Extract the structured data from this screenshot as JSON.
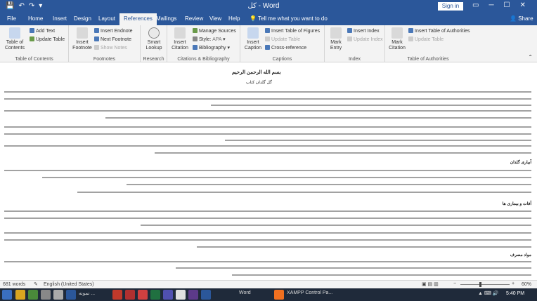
{
  "window": {
    "title": "کل - Word",
    "sign_in": "Sign in",
    "share": "Share",
    "tell_me": "Tell me what you want to do"
  },
  "tabs": [
    "File",
    "Home",
    "Insert",
    "Design",
    "Layout",
    "References",
    "Mailings",
    "Review",
    "View",
    "Help"
  ],
  "active_tab": "References",
  "ribbon": {
    "toc": {
      "table_of_contents": "Table of Contents",
      "add_text": "Add Text",
      "update_table": "Update Table",
      "group": "Table of Contents"
    },
    "footnotes": {
      "insert_footnote": "Insert Footnote",
      "insert_endnote": "Insert Endnote",
      "next_footnote": "Next Footnote",
      "show_notes": "Show Notes",
      "group": "Footnotes"
    },
    "research": {
      "smart_lookup": "Smart Lookup",
      "group": "Research"
    },
    "citations": {
      "insert_citation": "Insert Citation",
      "manage_sources": "Manage Sources",
      "style_label": "Style:",
      "style_value": "APA",
      "bibliography": "Bibliography",
      "group": "Citations & Bibliography"
    },
    "captions": {
      "insert_caption": "Insert Caption",
      "insert_table_of_figures": "Insert Table of Figures",
      "update_table": "Update Table",
      "cross_reference": "Cross-reference",
      "group": "Captions"
    },
    "index": {
      "mark_entry": "Mark Entry",
      "insert_index": "Insert Index",
      "update_index": "Update Index",
      "group": "Index"
    },
    "toa": {
      "mark_citation": "Mark Citation",
      "insert_toa": "Insert Table of Authorities",
      "update_table": "Update Table",
      "group": "Table of Authorities"
    }
  },
  "document": {
    "basmala": "بسم الله الرحمن الرحیم",
    "subtitle": "گل گلدان کتاب",
    "heading1": "آبیاری گلدان",
    "heading2": "آفات و بیماری ها",
    "heading3": "مواد مصرف"
  },
  "status": {
    "words": "681 words",
    "language": "English (United States)",
    "zoom": "60%"
  },
  "taskbar": {
    "item1": "نمونه ...",
    "item2": "Word",
    "item3": "XAMPP Control Pa...",
    "time": "5:40 PM"
  }
}
